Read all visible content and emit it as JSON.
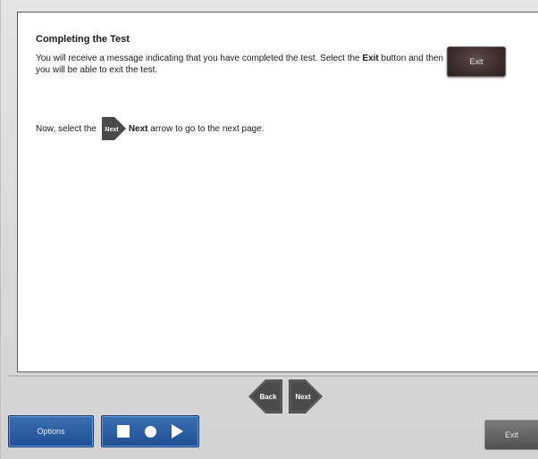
{
  "content": {
    "title": "Completing the Test",
    "para1_text": "You will receive a message indicating that you have completed the test. Select the ",
    "para1_bold": "Exit",
    "para1_tail": " button and then you will be able to exit the test.",
    "exit_inline_label": "Exit",
    "para2_prefix": "Now, select the",
    "next_inline_label": "Next",
    "para2_bold": "Next",
    "para2_tail": "arrow to go to the next page."
  },
  "navigation": {
    "back_label": "Back",
    "next_label": "Next"
  },
  "toolbar": {
    "options_label": "Options",
    "exit_label": "Exit"
  },
  "colors": {
    "blue_button": "#2a5fa3",
    "exit_dark": "#3b2d2d",
    "arrow_gray": "#4a4a4a"
  }
}
